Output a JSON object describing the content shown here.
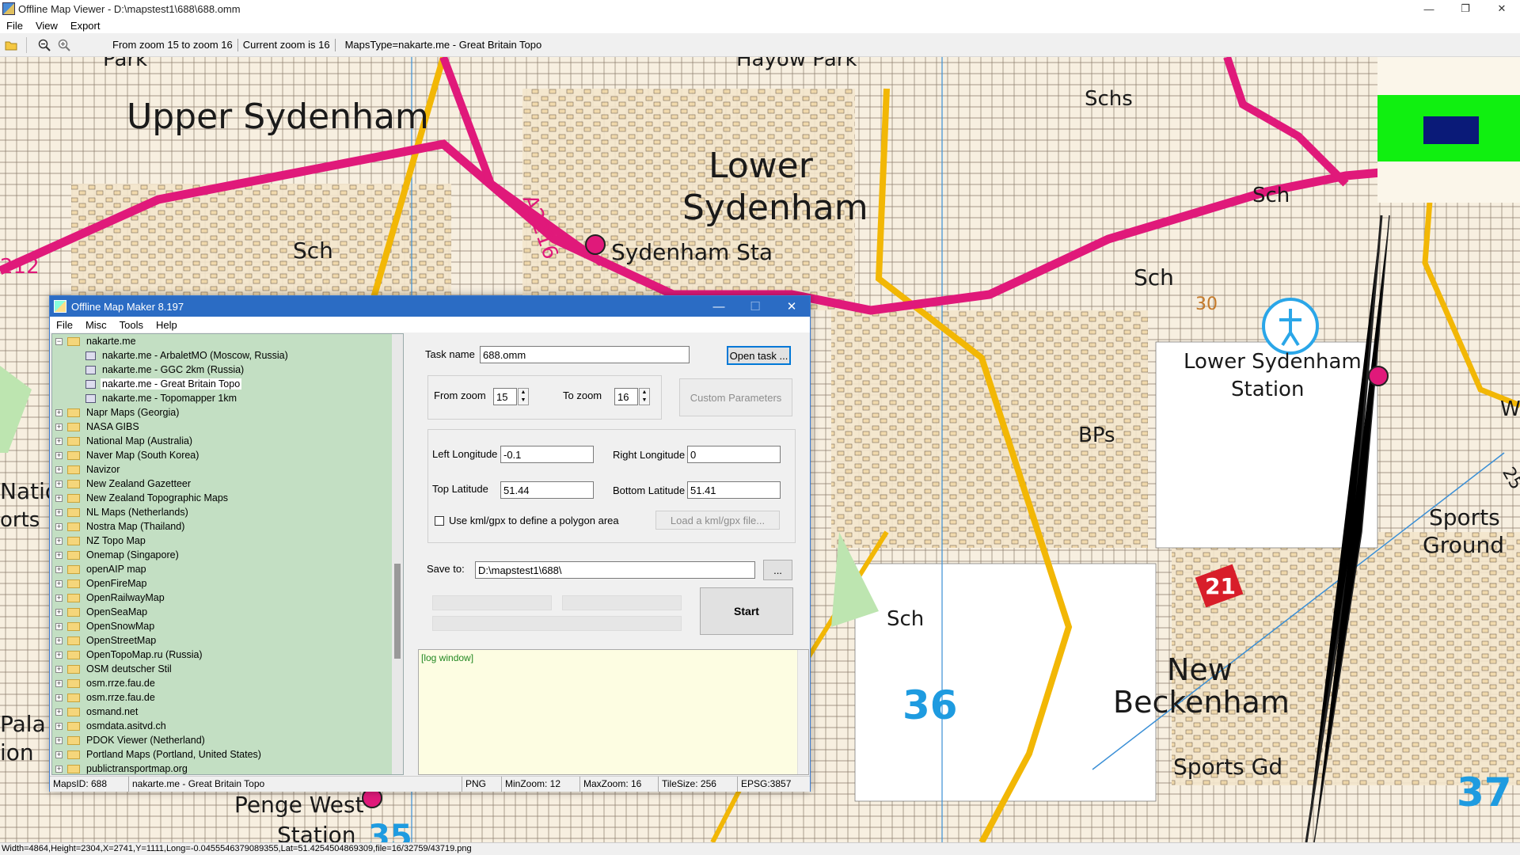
{
  "window": {
    "title": "Offline Map Viewer - D:\\mapstest1\\688\\688.omm",
    "controls": [
      "—",
      "❐",
      "✕"
    ]
  },
  "menu": [
    "File",
    "View",
    "Export"
  ],
  "toolbar": {
    "zoom_range": "From zoom 15 to zoom 16",
    "current_zoom": "Current zoom is 16",
    "maps_type": "MapsType=nakarte.me - Great Britain Topo"
  },
  "map": {
    "labels": {
      "upper_sydenham": "Upper Sydenham",
      "lower": "Lower",
      "sydenham": "Sydenham",
      "sydenham_sta": "Sydenham Sta",
      "lower_sydenham": "Lower Sydenham",
      "station": "Station",
      "schs": "Schs",
      "sch1": "Sch",
      "sch2": "Sch",
      "sch3": "Sch",
      "sch4": "Sch",
      "bps": "BPs",
      "sports": "Sports",
      "ground": "Ground",
      "new": "New",
      "beckenham": "Beckenham",
      "sports_gd": "Sports Gd",
      "penge_west": "Penge West",
      "road_a2216": "A2216",
      "road_212": "212",
      "grid_36": "36",
      "grid_37": "37",
      "route_21": "21",
      "natio": "Natio",
      "orts": "orts",
      "pala": "Pala",
      "ion": "ion",
      "park1": "Park",
      "park2": "Hayow Park",
      "station_frag": "Station",
      "num_35": "35",
      "num_25": "25",
      "num_30": "30",
      "num_w": "W"
    }
  },
  "statusbar": {
    "text": "Width=4864,Height=2304,X=2741,Y=1111,Long=-0.0455546379089355,Lat=51.4254504869309,file=16/32759/43719.png"
  },
  "dialog": {
    "title": "Offline Map Maker 8.197",
    "controls": [
      "—",
      "☐",
      "✕"
    ],
    "menu": [
      "File",
      "Misc",
      "Tools",
      "Help"
    ],
    "tree": {
      "root": "nakarte.me",
      "children": [
        "nakarte.me - ArbaletMO (Moscow, Russia)",
        "nakarte.me - GGC 2km (Russia)",
        "nakarte.me - Great Britain Topo",
        "nakarte.me - Topomapper 1km"
      ],
      "folders": [
        "Napr Maps (Georgia)",
        "NASA GIBS",
        "National Map (Australia)",
        "Naver Map (South Korea)",
        "Navizor",
        "New Zealand Gazetteer",
        "New Zealand Topographic Maps",
        "NL Maps (Netherlands)",
        "Nostra Map (Thailand)",
        "NZ Topo Map",
        "Onemap (Singapore)",
        "openAIP map",
        "OpenFireMap",
        "OpenRailwayMap",
        "OpenSeaMap",
        "OpenSnowMap",
        "OpenStreetMap",
        "OpenTopoMap.ru (Russia)",
        "OSM deutscher Stil",
        "osm.rrze.fau.de",
        "osm.rrze.fau.de",
        "osmand.net",
        "osmdata.asitvd.ch",
        "PDOK Viewer (Netherland)",
        "Portland Maps (Portland, United States)",
        "publictransportmap.org"
      ]
    },
    "form": {
      "task_name_label": "Task name",
      "task_name_value": "688.omm",
      "open_task_label": "Open task ...",
      "from_zoom_label": "From zoom",
      "from_zoom_value": "15",
      "to_zoom_label": "To zoom",
      "to_zoom_value": "16",
      "custom_params_label": "Custom Parameters",
      "left_long_label": "Left Longitude",
      "left_long_value": "-0.1",
      "right_long_label": "Right Longitude",
      "right_long_value": "0",
      "top_lat_label": "Top Latitude",
      "top_lat_value": "51.44",
      "bottom_lat_label": "Bottom Latitude",
      "bottom_lat_value": "51.41",
      "kml_label": "Use kml/gpx to define a polygon area",
      "load_kml_label": "Load a kml/gpx file...",
      "save_to_label": "Save to:",
      "save_to_value": "D:\\mapstest1\\688\\",
      "browse_label": "...",
      "start_label": "Start",
      "log_text": "[log window]"
    },
    "status": {
      "maps_id": "MapsID: 688",
      "maps_name": "nakarte.me - Great Britain Topo",
      "format": "PNG",
      "min_zoom": "MinZoom: 12",
      "max_zoom": "MaxZoom: 16",
      "tile_size": "TileSize: 256",
      "epsg": "EPSG:3857"
    }
  },
  "colors": {
    "dialog_title_bg": "#2b6cc4",
    "tree_bg": "#c3dfc3",
    "log_bg": "#fdfde2",
    "road_magenta": "#e0197a",
    "road_yellow": "#f2b705",
    "overlay_green": "#10f010",
    "overlay_navy": "#0a1a78"
  },
  "icons": [
    "app-icon",
    "open-folder-icon",
    "zoom-out-icon",
    "zoom-in-icon",
    "folder-icon",
    "map-layer-icon",
    "expand-icon",
    "collapse-icon",
    "checkbox-icon",
    "spin-up-icon",
    "spin-down-icon"
  ]
}
